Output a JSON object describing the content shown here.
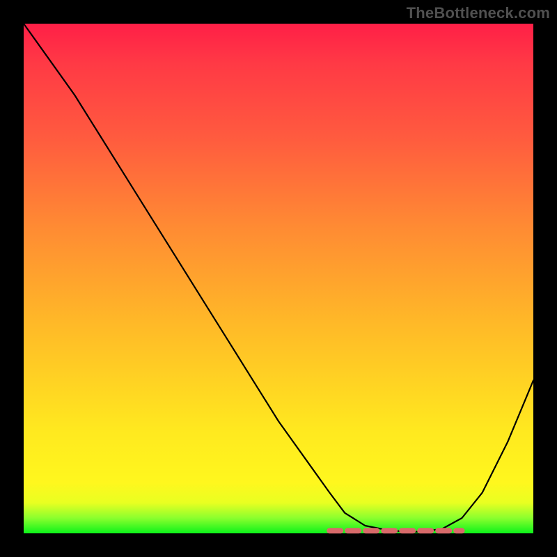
{
  "watermark": "TheBottleneck.com",
  "chart_data": {
    "type": "line",
    "title": "",
    "xlabel": "",
    "ylabel": "",
    "xlim": [
      0,
      100
    ],
    "ylim": [
      0,
      100
    ],
    "grid": false,
    "legend": false,
    "series": [
      {
        "name": "bottleneck-curve",
        "x": [
          0,
          5,
          10,
          15,
          20,
          25,
          30,
          35,
          40,
          45,
          50,
          55,
          60,
          63,
          67,
          72,
          77,
          82,
          86,
          90,
          95,
          100
        ],
        "y": [
          100,
          93,
          86,
          78,
          70,
          62,
          54,
          46,
          38,
          30,
          22,
          15,
          8,
          4,
          1.5,
          0.5,
          0.3,
          0.8,
          3,
          8,
          18,
          30
        ]
      }
    ],
    "annotations": [
      {
        "name": "flat-minimum-band",
        "x_start": 60,
        "x_end": 86,
        "y": 0.5
      }
    ],
    "background_gradient": {
      "direction": "vertical",
      "stops": [
        {
          "pos": 0,
          "color": "#ff1f47"
        },
        {
          "pos": 40,
          "color": "#ff8b33"
        },
        {
          "pos": 80,
          "color": "#ffe91f"
        },
        {
          "pos": 100,
          "color": "#0cf31a"
        }
      ]
    }
  }
}
